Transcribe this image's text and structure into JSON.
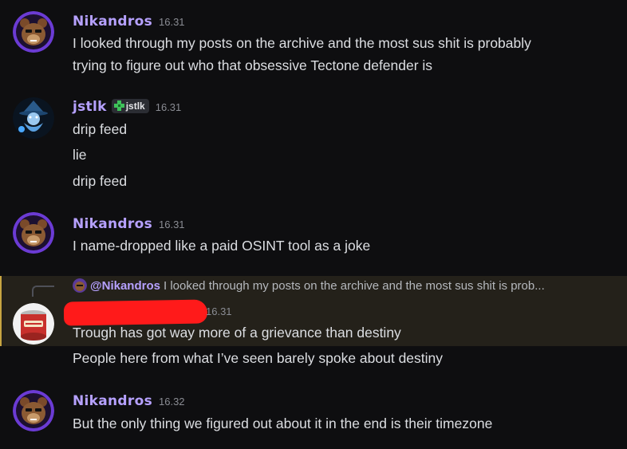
{
  "messages": [
    {
      "username": "Nikandros",
      "time": "16.31",
      "lines": [
        "I looked through my posts on the archive and the most sus shit is probably",
        "trying to figure out who that obsessive Tectone defender is"
      ]
    },
    {
      "username": "jstlk",
      "time": "16.31",
      "tag": "jstlk",
      "lines": [
        "drip feed",
        "lie",
        "drip feed"
      ]
    },
    {
      "username": "Nikandros",
      "time": "16.31",
      "lines": [
        "I name-dropped like a paid OSINT tool as a joke"
      ]
    },
    {
      "reply": {
        "mention": "@Nikandros",
        "preview": "I looked through my posts on the archive and the most sus shit is prob..."
      },
      "time": "16.31",
      "lines": [
        "Trough has got way more of a grievance than destiny",
        "People here from what I’ve seen barely spoke about destiny"
      ]
    },
    {
      "username": "Nikandros",
      "time": "16.32",
      "lines": [
        "But the only thing we figured out about it in the end is their timezone"
      ]
    }
  ],
  "colors": {
    "background": "#0e0e10",
    "username": "#b6a1ff",
    "highlight": "#24211a",
    "highlight_border": "#c7a542",
    "redaction": "#ff1a1a"
  },
  "icons": [
    "bear-avatar",
    "wizard-avatar",
    "can-avatar",
    "guild-tag-icon"
  ]
}
